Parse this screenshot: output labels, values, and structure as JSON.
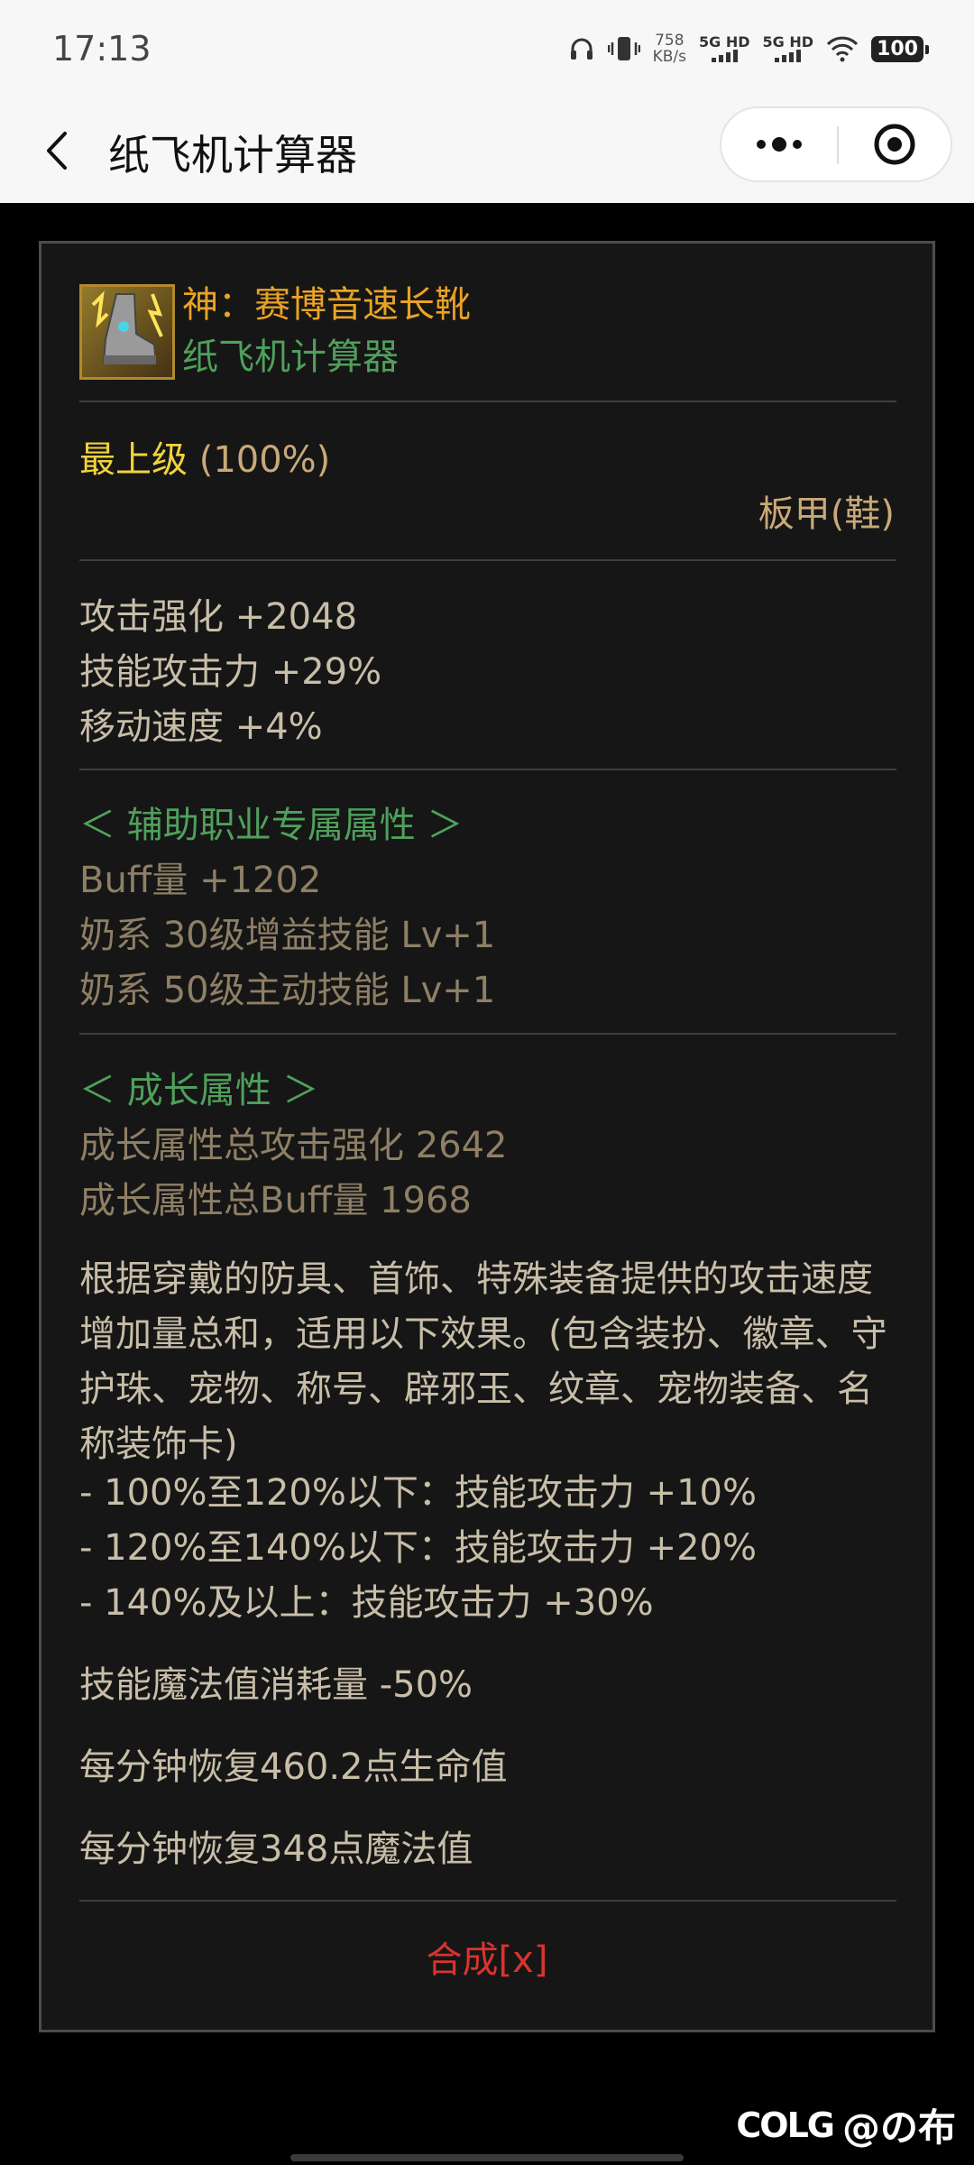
{
  "status_bar": {
    "time": "17:13",
    "net_speed_value": "758",
    "net_speed_unit": "KB/s",
    "sim1": "5G HD",
    "sim2": "5G HD",
    "battery": "100"
  },
  "nav": {
    "title": "纸飞机计算器"
  },
  "item": {
    "name": "神：赛博音速长靴",
    "source": "纸飞机计算器",
    "grade_label": "最上级",
    "grade_pct": "(100%)",
    "type": "板甲(鞋)",
    "stats": [
      "攻击强化 +2048",
      "技能攻击力 +29%",
      "移动速度 +4%"
    ],
    "support_header": "＜ 辅助职业专属属性 ＞",
    "support_stats": [
      "Buff量 +1202",
      "奶系 30级增益技能 Lv+1",
      "奶系 50级主动技能 Lv+1"
    ],
    "growth_header": "＜ 成长属性 ＞",
    "growth_stats": [
      "成长属性总攻击强化 2642",
      "成长属性总Buff量 1968"
    ],
    "description": "根据穿戴的防具、首饰、特殊装备提供的攻击速度增加量总和，适用以下效果。(包含装扮、徽章、守护珠、宠物、称号、辟邪玉、纹章、宠物装备、名称装饰卡)",
    "tiers": [
      "- 100%至120%以下：技能攻击力 +10%",
      "- 120%至140%以下：技能攻击力 +20%",
      "- 140%及以上：技能攻击力 +30%"
    ],
    "mp_cost": "技能魔法值消耗量 -50%",
    "hp_regen": "每分钟恢复460.2点生命值",
    "mp_regen": "每分钟恢复348点魔法值",
    "synthesize": "合成[x]"
  },
  "watermark": {
    "logo": "COLG",
    "user": "@の布"
  },
  "colors": {
    "gold_text": "#c9a978",
    "green_text": "#4fa05b",
    "yellow_text": "#f1d33c",
    "orange_text": "#e9a325",
    "red_text": "#d7342d"
  }
}
